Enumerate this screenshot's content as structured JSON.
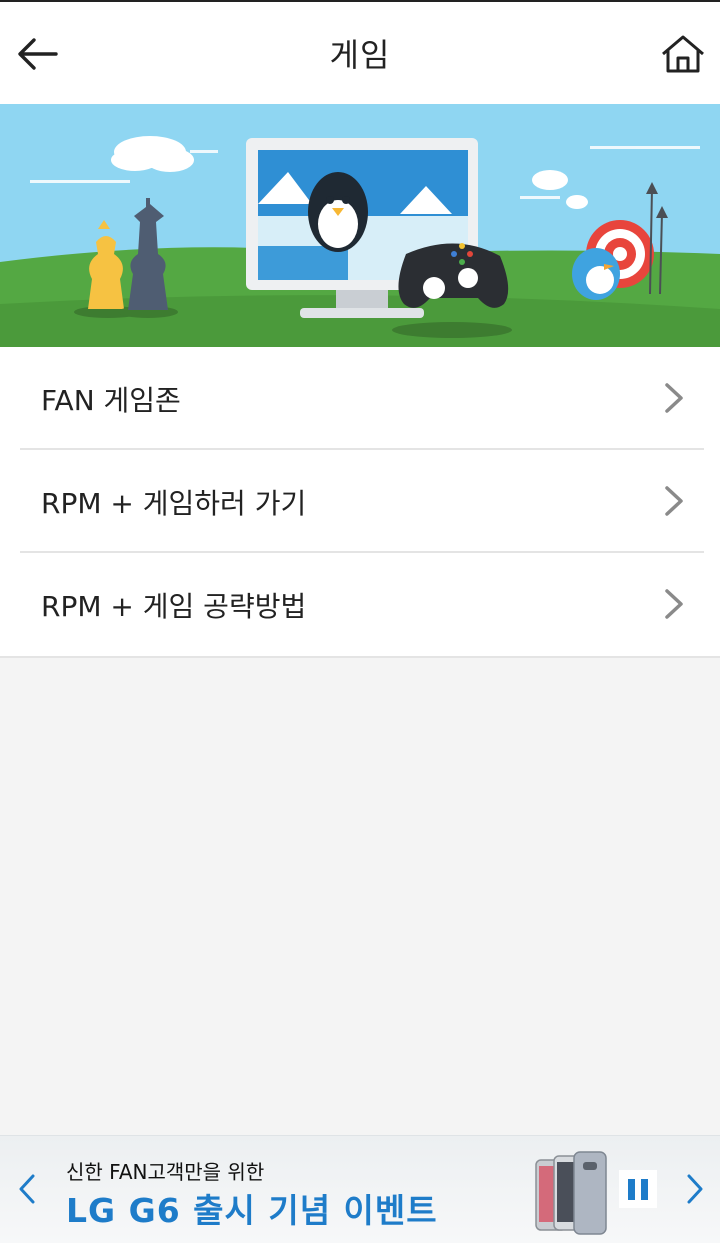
{
  "header": {
    "title": "게임"
  },
  "banner": {
    "alt": ""
  },
  "menu": {
    "items": [
      {
        "label": "FAN 게임존"
      },
      {
        "label": "RPM + 게임하러 가기"
      },
      {
        "label": "RPM + 게임 공략방법"
      }
    ]
  },
  "ad": {
    "subtitle": "신한 FAN고객만을 위한",
    "headline": "LG G6 출시 기념 이벤트"
  },
  "colors": {
    "accent": "#1e7cc9",
    "sky": "#8fd6f2",
    "grass": "#54a843"
  }
}
